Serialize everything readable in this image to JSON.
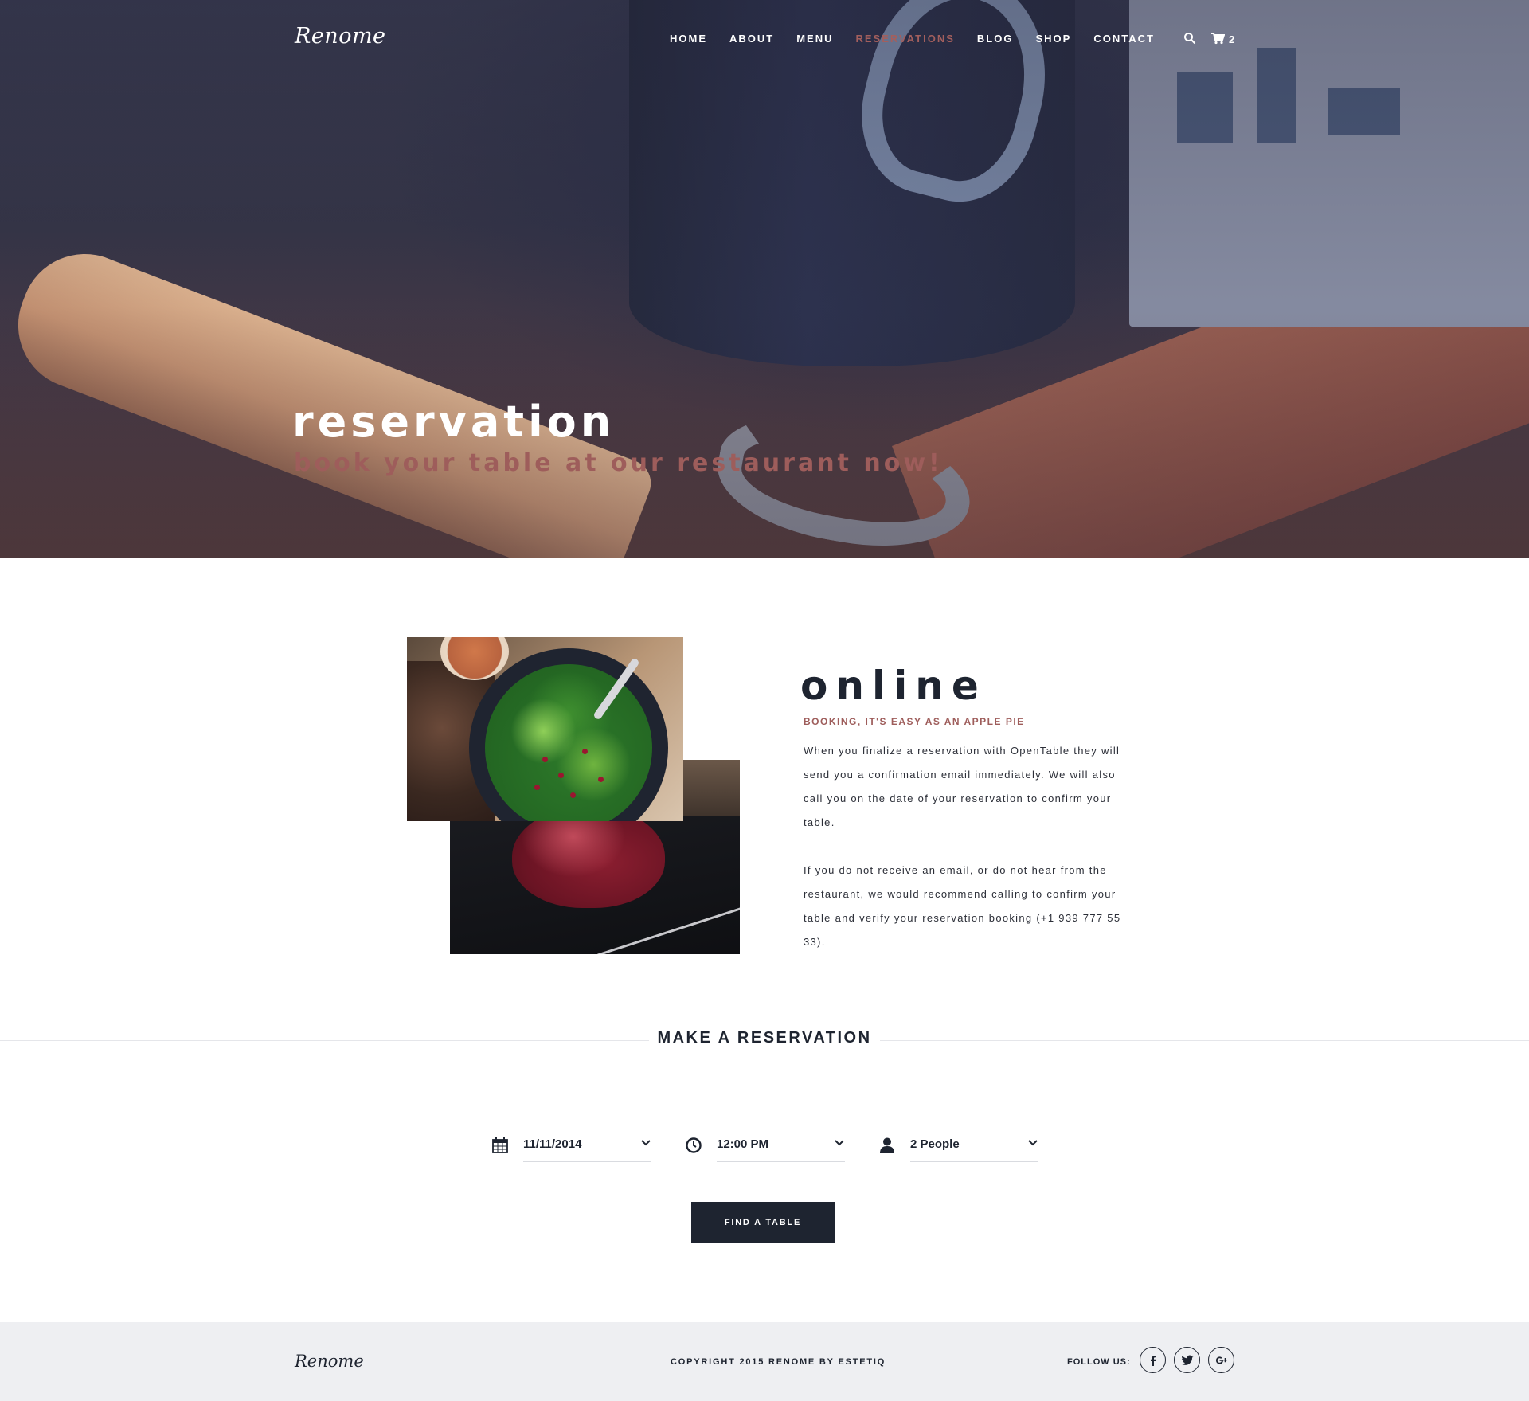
{
  "brand": {
    "logo": "Renome"
  },
  "nav": {
    "items": [
      {
        "label": "HOME"
      },
      {
        "label": "ABOUT"
      },
      {
        "label": "MENU"
      },
      {
        "label": "RESERVATIONS",
        "active": true
      },
      {
        "label": "BLOG"
      },
      {
        "label": "SHOP"
      },
      {
        "label": "CONTACT"
      }
    ],
    "search_icon": "search-icon",
    "cart_icon": "cart-icon",
    "cart_count": "2"
  },
  "hero": {
    "title": "reservation",
    "subtitle": "book your table at our restaurant now!"
  },
  "online": {
    "title": "online",
    "subtitle": "BOOKING, IT'S EASY AS AN APPLE PIE",
    "paragraph1": "When you finalize a reservation with OpenTable they will send you a confirmation email immediately.  We will also call you on the date of your reservation to confirm your table.",
    "paragraph2": "If you do not receive an email, or do not hear from the restaurant, we would recommend calling to confirm your table and verify your reservation booking (+1 939 777 55 33)."
  },
  "reservation": {
    "title": "MAKE A RESERVATION",
    "date": {
      "value": "11/11/2014",
      "icon": "calendar-icon"
    },
    "time": {
      "value": "12:00 PM",
      "icon": "clock-icon"
    },
    "people": {
      "value": "2 People",
      "icon": "person-icon"
    },
    "button": "FIND A TABLE"
  },
  "footer": {
    "logo": "Renome",
    "copyright": "COPYRIGHT 2015 RENOME BY ESTETIQ",
    "follow_label": "FOLLOW US:",
    "social": [
      "facebook-icon",
      "twitter-icon",
      "google-plus-icon"
    ]
  },
  "colors": {
    "accent": "#9e5d5b",
    "dark": "#1e2430",
    "footer_bg": "#eeeff2"
  }
}
